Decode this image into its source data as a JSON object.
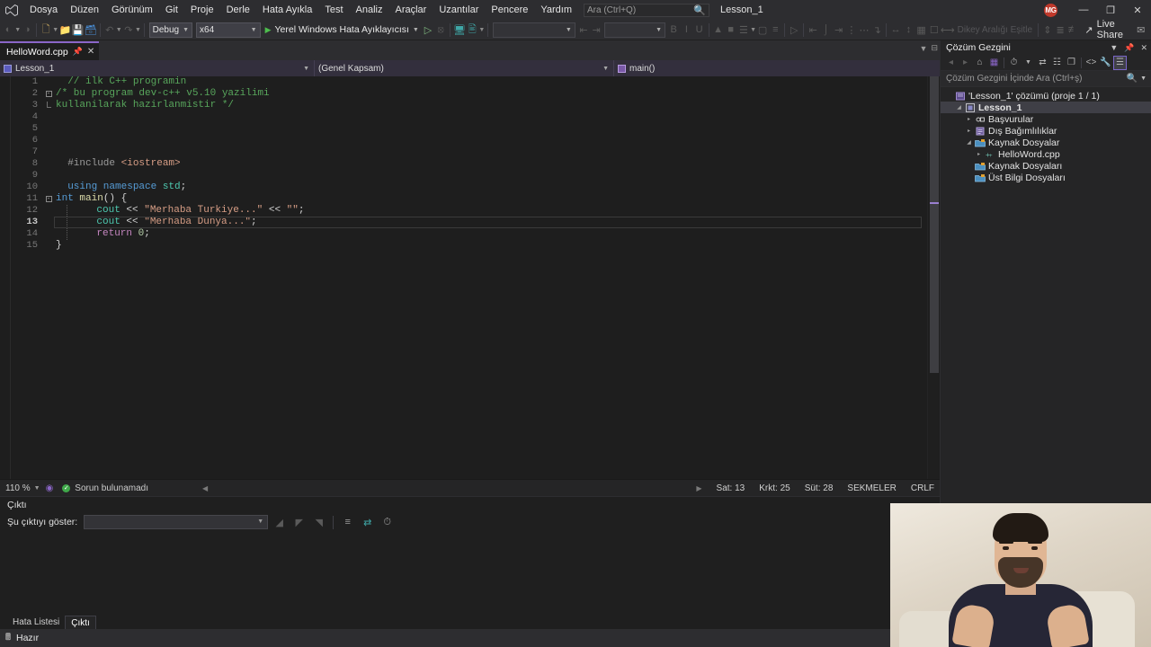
{
  "app": {
    "project_name": "Lesson_1",
    "avatar_initials": "MG"
  },
  "menu": {
    "logo_icon": "visual-studio-logo-icon",
    "items": [
      {
        "label": "Dosya"
      },
      {
        "label": "Düzen"
      },
      {
        "label": "Görünüm"
      },
      {
        "label": "Git"
      },
      {
        "label": "Proje"
      },
      {
        "label": "Derle"
      },
      {
        "label": "Hata Ayıkla"
      },
      {
        "label": "Test"
      },
      {
        "label": "Analiz"
      },
      {
        "label": "Araçlar"
      },
      {
        "label": "Uzantılar"
      },
      {
        "label": "Pencere"
      },
      {
        "label": "Yardım"
      }
    ]
  },
  "search": {
    "placeholder": "Ara (Ctrl+Q)",
    "value": "",
    "icon": "search-icon"
  },
  "window_controls": {
    "minimize": "—",
    "maximize": "❐",
    "close": "✕"
  },
  "toolbar": {
    "config": {
      "value": "Debug"
    },
    "platform": {
      "value": "x64"
    },
    "run": {
      "label": "Yerel Windows Hata Ayıklayıcısı"
    },
    "vertical_spacing_label": "Dikey Aralığı Eşitle",
    "live_share": {
      "label": "Live Share"
    },
    "empty_combo_1": "",
    "empty_combo_2": ""
  },
  "editor": {
    "tab": {
      "label": "HelloWord.cpp",
      "pin_icon": "pin-icon",
      "close_icon": "close-icon"
    },
    "nav": {
      "project": "Lesson_1",
      "scope": "(Genel Kapsam)",
      "member": "main()"
    },
    "lines": [
      {
        "n": "1",
        "indent": 2,
        "tokens": [
          {
            "t": "// ilk C++ programin",
            "c": "c-com"
          }
        ]
      },
      {
        "n": "2",
        "indent": 0,
        "fold": "minus",
        "tokens": [
          {
            "t": "/* bu program dev-c++ v5.10 yazilimi",
            "c": "c-com"
          }
        ]
      },
      {
        "n": "3",
        "indent": 0,
        "fold": "end",
        "tokens": [
          {
            "t": "kullanilarak hazirlanmistir */",
            "c": "c-com"
          }
        ]
      },
      {
        "n": "4",
        "indent": 0,
        "tokens": []
      },
      {
        "n": "5",
        "indent": 0,
        "tokens": []
      },
      {
        "n": "6",
        "indent": 0,
        "tokens": []
      },
      {
        "n": "7",
        "indent": 0,
        "tokens": []
      },
      {
        "n": "8",
        "indent": 2,
        "tokens": [
          {
            "t": "#include ",
            "c": "c-pp"
          },
          {
            "t": "<iostream>",
            "c": "c-inc"
          }
        ]
      },
      {
        "n": "9",
        "indent": 0,
        "tokens": []
      },
      {
        "n": "10",
        "indent": 2,
        "tokens": [
          {
            "t": "using namespace ",
            "c": "c-kw"
          },
          {
            "t": "std",
            "c": "c-type"
          },
          {
            "t": ";",
            "c": "c-op"
          }
        ]
      },
      {
        "n": "11",
        "indent": 0,
        "fold": "minus",
        "tokens": [
          {
            "t": "int ",
            "c": "c-kw"
          },
          {
            "t": "main",
            "c": "c-fn"
          },
          {
            "t": "() {",
            "c": "c-op"
          }
        ]
      },
      {
        "n": "12",
        "indent": 4,
        "guide": true,
        "tokens": [
          {
            "t": "cout",
            "c": "c-type"
          },
          {
            "t": " << ",
            "c": "c-op"
          },
          {
            "t": "\"Merhaba Turkiye...\"",
            "c": "c-str"
          },
          {
            "t": " << ",
            "c": "c-op"
          },
          {
            "t": "\"\"",
            "c": "c-str"
          },
          {
            "t": ";",
            "c": "c-op"
          }
        ]
      },
      {
        "n": "13",
        "indent": 4,
        "guide": true,
        "current": true,
        "tokens": [
          {
            "t": "cout",
            "c": "c-type"
          },
          {
            "t": " << ",
            "c": "c-op"
          },
          {
            "t": "\"Merhaba Dunya...\"",
            "c": "c-str"
          },
          {
            "t": ";",
            "c": "c-op"
          }
        ]
      },
      {
        "n": "14",
        "indent": 4,
        "guide": true,
        "tokens": [
          {
            "t": "return ",
            "c": "c-pl"
          },
          {
            "t": "0",
            "c": "c-num"
          },
          {
            "t": ";",
            "c": "c-op"
          }
        ]
      },
      {
        "n": "15",
        "indent": 0,
        "tokens": [
          {
            "t": "}",
            "c": "c-op"
          }
        ]
      }
    ],
    "status": {
      "zoom": "110 %",
      "health_icon": "check-circle-icon",
      "health_text": "Sorun bulunamadı",
      "line": "Sat: 13",
      "char": "Krkt: 25",
      "col": "Süt: 28",
      "tabs_mode": "SEKMELER",
      "eol": "CRLF"
    }
  },
  "output": {
    "title": "Çıktı",
    "show_label": "Şu çıktıyı göster:",
    "source_value": "",
    "body_text": "",
    "tools": [
      {
        "icon": "output-find-icon"
      },
      {
        "icon": "output-clear-icon"
      },
      {
        "icon": "output-clearall-icon"
      },
      {
        "icon": "word-wrap-icon"
      },
      {
        "icon": "goto-message-icon"
      },
      {
        "icon": "timestamp-icon"
      }
    ],
    "panel_tabs": [
      {
        "label": "Hata Listesi",
        "active": false
      },
      {
        "label": "Çıktı",
        "active": true
      }
    ]
  },
  "solution_explorer": {
    "title": "Çözüm Gezgini",
    "header_icons": [
      {
        "icon": "chevron-down-icon"
      },
      {
        "icon": "pin-icon"
      },
      {
        "icon": "close-icon"
      }
    ],
    "toolbar_icons": [
      {
        "icon": "back-icon",
        "state": "disabled"
      },
      {
        "icon": "forward-icon",
        "state": "disabled"
      },
      {
        "icon": "home-icon",
        "state": "normal"
      },
      {
        "icon": "solution-view-icon",
        "state": "normal"
      },
      {
        "icon": "pending-changes-icon",
        "state": "normal"
      },
      {
        "icon": "sync-icon",
        "state": "normal"
      },
      {
        "icon": "collapse-all-icon",
        "state": "normal"
      },
      {
        "icon": "refresh-icon",
        "state": "normal"
      },
      {
        "icon": "show-all-files-icon",
        "state": "normal"
      },
      {
        "icon": "properties-icon",
        "state": "normal"
      },
      {
        "icon": "preview-selected-icon",
        "state": "selected"
      }
    ],
    "search": {
      "placeholder": "Çözüm Gezgini İçinde Ara (Ctrl+ş)",
      "value": "",
      "icon": "search-icon"
    },
    "tree": [
      {
        "depth": 0,
        "twist": "none",
        "icon": "solution-icon",
        "label": "'Lesson_1' çözümü (proje 1 / 1)",
        "bold": false,
        "selected": false
      },
      {
        "depth": 1,
        "twist": "open",
        "icon": "project-icon",
        "label": "Lesson_1",
        "bold": true,
        "selected": true
      },
      {
        "depth": 2,
        "twist": "closed",
        "icon": "references-icon",
        "label": "Başvurular",
        "bold": false,
        "selected": false
      },
      {
        "depth": 2,
        "twist": "closed",
        "icon": "dependencies-icon",
        "label": "Dış Bağımlılıklar",
        "bold": false,
        "selected": false
      },
      {
        "depth": 2,
        "twist": "open",
        "icon": "folder-icon",
        "label": "Kaynak Dosyalar",
        "bold": false,
        "selected": false
      },
      {
        "depth": 3,
        "twist": "closed",
        "icon": "cpp-file-icon",
        "label": "HelloWord.cpp",
        "bold": false,
        "selected": false
      },
      {
        "depth": 2,
        "twist": "none",
        "icon": "folder-icon",
        "label": "Kaynak Dosyaları",
        "bold": false,
        "selected": false
      },
      {
        "depth": 2,
        "twist": "none",
        "icon": "folder-icon",
        "label": "Üst Bilgi Dosyaları",
        "bold": false,
        "selected": false
      }
    ]
  },
  "statusbar": {
    "icon": "ready-icon",
    "text": "Hazır"
  },
  "colors": {
    "accent_purple": "#8a65c7",
    "titlebar_bg": "#2d2d30",
    "editor_bg": "#1e1e1e",
    "panel_bg": "#252526",
    "avatar_red": "#c0392b",
    "run_green": "#4dbd4d",
    "comment_green": "#58a65c",
    "string_orange": "#d69d85",
    "keyword_blue": "#569cd6",
    "type_teal": "#4ec9b0"
  }
}
